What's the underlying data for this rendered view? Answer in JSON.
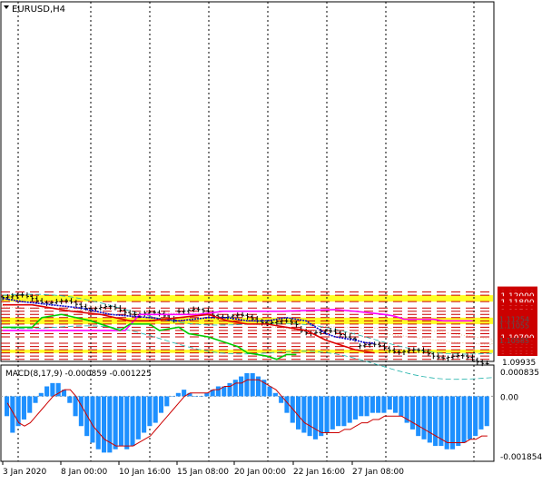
{
  "chart_data": [
    {
      "type": "line",
      "title": "EURUSD,H4",
      "x_ticks": [
        "3 Jan 2020",
        "8 Jan 00:00",
        "10 Jan 16:00",
        "15 Jan 08:00",
        "20 Jan 00:00",
        "22 Jan 16:00",
        "27 Jan 08:00"
      ],
      "ylim": [
        1.09935,
        1.2115
      ],
      "price_levels": [
        "1.12100",
        "1.12000",
        "1.11800",
        "1.11600",
        "1.11500",
        "1.11400",
        "1.11300",
        "1.11200",
        "1.11100",
        "1.11000",
        "1.10900",
        "1.10800",
        "1.10700",
        "1.10500",
        "1.10400",
        "1.10300",
        "1.10200",
        "1.10100",
        "1.10000"
      ],
      "partial_labels": [
        "1.11254",
        "1.11055",
        "1.10585"
      ],
      "current_price_label": "1.09935",
      "zones": [
        {
          "from": 1.118,
          "to": 1.12
        },
        {
          "from": 1.111,
          "to": 1.113
        },
        {
          "from": 1.102,
          "to": 1.103
        }
      ],
      "series": [
        {
          "name": "",
          "color": "#ff00ff",
          "points": [
            [
              0,
              1.109
            ],
            [
              25,
              1.109
            ],
            [
              28,
              1.114
            ],
            [
              40,
              1.114
            ],
            [
              45,
              1.115
            ],
            [
              55,
              1.115
            ],
            [
              57,
              1.115
            ],
            [
              68,
              1.1155
            ],
            [
              72,
              1.115
            ],
            [
              78,
              1.114
            ],
            [
              80,
              1.1135
            ],
            [
              82,
              1.1125
            ],
            [
              88,
              1.1125
            ],
            [
              90,
              1.112
            ],
            [
              96,
              1.112
            ]
          ]
        },
        {
          "name": "",
          "color": "#00cc00",
          "points": [
            [
              0,
              1.11
            ],
            [
              6,
              1.11
            ],
            [
              8,
              1.113
            ],
            [
              12,
              1.114
            ],
            [
              18,
              1.112
            ],
            [
              24,
              1.109
            ],
            [
              26,
              1.111
            ],
            [
              30,
              1.111
            ],
            [
              32,
              1.109
            ],
            [
              36,
              1.11
            ],
            [
              38,
              1.108
            ],
            [
              42,
              1.107
            ],
            [
              46,
              1.105
            ],
            [
              48,
              1.104
            ],
            [
              50,
              1.102
            ],
            [
              54,
              1.101
            ],
            [
              56,
              1.1
            ],
            [
              58,
              1.1015
            ],
            [
              60,
              1.1015
            ]
          ]
        },
        {
          "name": "",
          "color": "#0000cc",
          "points": [
            [
              0,
              1.119
            ],
            [
              4,
              1.118
            ],
            [
              10,
              1.117
            ],
            [
              16,
              1.116
            ],
            [
              22,
              1.114
            ],
            [
              30,
              1.113
            ],
            [
              36,
              1.112
            ],
            [
              42,
              1.113
            ],
            [
              46,
              1.113
            ],
            [
              50,
              1.112
            ],
            [
              54,
              1.112
            ],
            [
              58,
              1.113
            ],
            [
              62,
              1.112
            ],
            [
              64,
              1.11
            ],
            [
              66,
              1.108
            ],
            [
              68,
              1.107
            ],
            [
              72,
              1.106
            ],
            [
              74,
              1.1052
            ],
            [
              76,
              1.105
            ]
          ]
        },
        {
          "name": "",
          "color": "#dd0000",
          "points": [
            [
              0,
              1.117
            ],
            [
              6,
              1.117
            ],
            [
              10,
              1.116
            ],
            [
              14,
              1.115
            ],
            [
              20,
              1.114
            ],
            [
              26,
              1.112
            ],
            [
              30,
              1.112
            ],
            [
              36,
              1.113
            ],
            [
              42,
              1.114
            ],
            [
              46,
              1.112
            ],
            [
              50,
              1.111
            ],
            [
              54,
              1.111
            ],
            [
              58,
              1.11
            ],
            [
              62,
              1.109
            ],
            [
              66,
              1.106
            ],
            [
              70,
              1.104
            ],
            [
              72,
              1.103
            ],
            [
              74,
              1.1025
            ],
            [
              76,
              1.102
            ]
          ]
        }
      ]
    },
    {
      "type": "bar",
      "title": "MACD(8,17,9) -0.000859 -0.001225",
      "ylim": [
        -0.001854,
        0.000835
      ],
      "y_labels": [
        "0.000835",
        "0.00",
        "-0.001854"
      ],
      "histogram": [
        -0.0006,
        -0.0011,
        -0.0009,
        -0.0007,
        -0.0005,
        -0.0002,
        0.0001,
        0.0003,
        0.0004,
        0.0004,
        0.0002,
        -0.0002,
        -0.0006,
        -0.0009,
        -0.0012,
        -0.0014,
        -0.0016,
        -0.0017,
        -0.0017,
        -0.0016,
        -0.0015,
        -0.0016,
        -0.0015,
        -0.0013,
        -0.0011,
        -0.0009,
        -0.0008,
        -0.0005,
        -0.0003,
        0.0,
        0.0001,
        0.0002,
        0.0001,
        0.0,
        0.0,
        0.0001,
        0.0002,
        0.0003,
        0.0003,
        0.0004,
        0.0005,
        0.0006,
        0.0007,
        0.0007,
        0.0006,
        0.0005,
        0.0003,
        0.0001,
        -0.0002,
        -0.0005,
        -0.0008,
        -0.001,
        -0.0011,
        -0.0012,
        -0.0013,
        -0.0012,
        -0.0011,
        -0.001,
        -0.0009,
        -0.0009,
        -0.0008,
        -0.0007,
        -0.0006,
        -0.0006,
        -0.0005,
        -0.0005,
        -0.0005,
        -0.0004,
        -0.0005,
        -0.0006,
        -0.0008,
        -0.001,
        -0.0012,
        -0.0013,
        -0.0014,
        -0.0015,
        -0.0015,
        -0.0016,
        -0.0016,
        -0.0015,
        -0.0014,
        -0.0013,
        -0.0012,
        -0.001,
        -0.0009
      ],
      "signal": [
        -0.0002,
        -0.0005,
        -0.0008,
        -0.0009,
        -0.0008,
        -0.0006,
        -0.0004,
        -0.0002,
        0.0,
        0.0001,
        0.0002,
        0.0002,
        0.0,
        -0.0003,
        -0.0006,
        -0.0009,
        -0.0011,
        -0.0013,
        -0.0014,
        -0.0015,
        -0.0015,
        -0.0015,
        -0.0015,
        -0.0014,
        -0.0013,
        -0.0012,
        -0.001,
        -0.0008,
        -0.0006,
        -0.0004,
        -0.0002,
        0.0,
        0.0001,
        0.0001,
        0.0001,
        0.0001,
        0.0002,
        0.0002,
        0.0003,
        0.0003,
        0.0004,
        0.0004,
        0.0005,
        0.0005,
        0.0005,
        0.0004,
        0.0003,
        0.0002,
        0.0,
        -0.0002,
        -0.0004,
        -0.0006,
        -0.0008,
        -0.0009,
        -0.001,
        -0.0011,
        -0.0011,
        -0.0011,
        -0.0011,
        -0.001,
        -0.001,
        -0.0009,
        -0.0008,
        -0.0008,
        -0.0007,
        -0.0007,
        -0.0006,
        -0.0006,
        -0.0006,
        -0.0006,
        -0.0007,
        -0.0008,
        -0.0009,
        -0.001,
        -0.0011,
        -0.0012,
        -0.0013,
        -0.0014,
        -0.0014,
        -0.0014,
        -0.0014,
        -0.0013,
        -0.0013,
        -0.0012,
        -0.0012
      ]
    }
  ],
  "colors": {
    "level_line": "#cc0000",
    "zone_fill": "#ffff00",
    "level_label_bg": "#cc0000",
    "current_label_bg": "#000000",
    "macd_hist": "#1e90ff",
    "macd_signal": "#cc0000",
    "ichimoku_cloud": "#f4a460",
    "envelope": "#20b2aa"
  }
}
